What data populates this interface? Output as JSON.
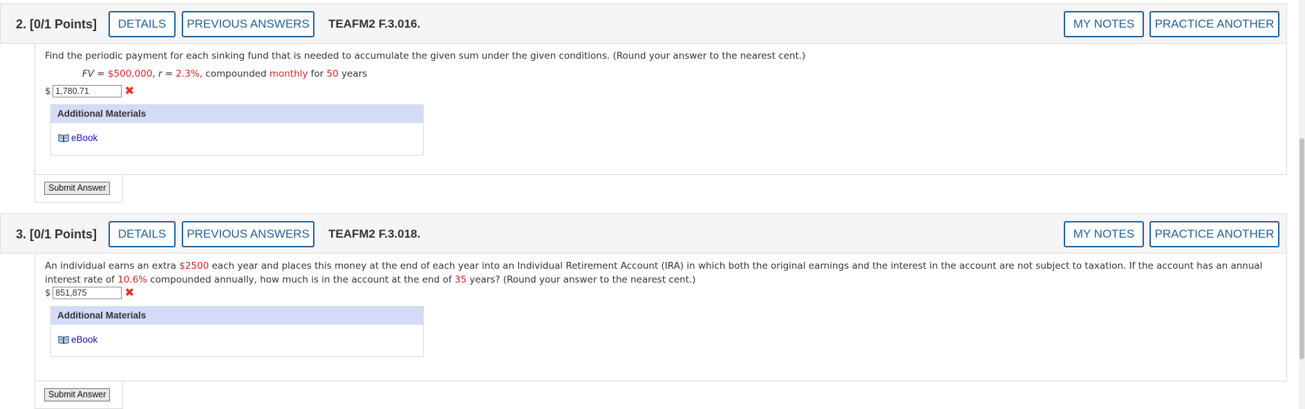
{
  "questions": [
    {
      "number": "2.",
      "points": "[0/1 Points]",
      "details_label": "DETAILS",
      "previous_label": "PREVIOUS ANSWERS",
      "code": "TEAFM2 F.3.016.",
      "my_notes_label": "MY NOTES",
      "practice_label": "PRACTICE ANOTHER",
      "prompt": "Find the periodic payment for each sinking fund that is needed to accumulate the given sum under the given conditions. (Round your answer to the nearest cent.)",
      "formula": {
        "fv_label": "FV",
        "fv_eq": " = ",
        "fv_value": "$500,000",
        "r_sep": ", ",
        "r_label": "r",
        "r_eq": " = ",
        "r_value": "2.3%",
        "comp_text": ", compounded ",
        "freq": "monthly",
        "for_text": " for ",
        "years_value": "50",
        "years_text": " years"
      },
      "currency": "$",
      "answer_value": "1,780.71",
      "additional_materials_label": "Additional Materials",
      "ebook_label": "eBook",
      "submit_label": "Submit Answer"
    },
    {
      "number": "3.",
      "points": "[0/1 Points]",
      "details_label": "DETAILS",
      "previous_label": "PREVIOUS ANSWERS",
      "code": "TEAFM2 F.3.018.",
      "my_notes_label": "MY NOTES",
      "practice_label": "PRACTICE ANOTHER",
      "prompt_parts": {
        "p1": "An individual earns an extra ",
        "amount": "$2500",
        "p2": " each year and places this money at the end of each year into an Individual Retirement Account (IRA) in which both the original earnings and the interest in the account are not subject to taxation. If the account has an annual interest rate of ",
        "rate": "10.6%",
        "p3": " compounded annually, how much is in the account at the end of ",
        "years": "35",
        "p4": " years? (Round your answer to the nearest cent.)"
      },
      "currency": "$",
      "answer_value": "851,875",
      "additional_materials_label": "Additional Materials",
      "ebook_label": "eBook",
      "submit_label": "Submit Answer"
    }
  ],
  "colors": {
    "accent_blue": "#1f5f97",
    "highlight_red": "#d2232a",
    "materials_header": "#d3dbf7",
    "link": "#1a0dab"
  },
  "icons": {
    "incorrect": "x-mark-icon",
    "ebook": "book-icon"
  }
}
